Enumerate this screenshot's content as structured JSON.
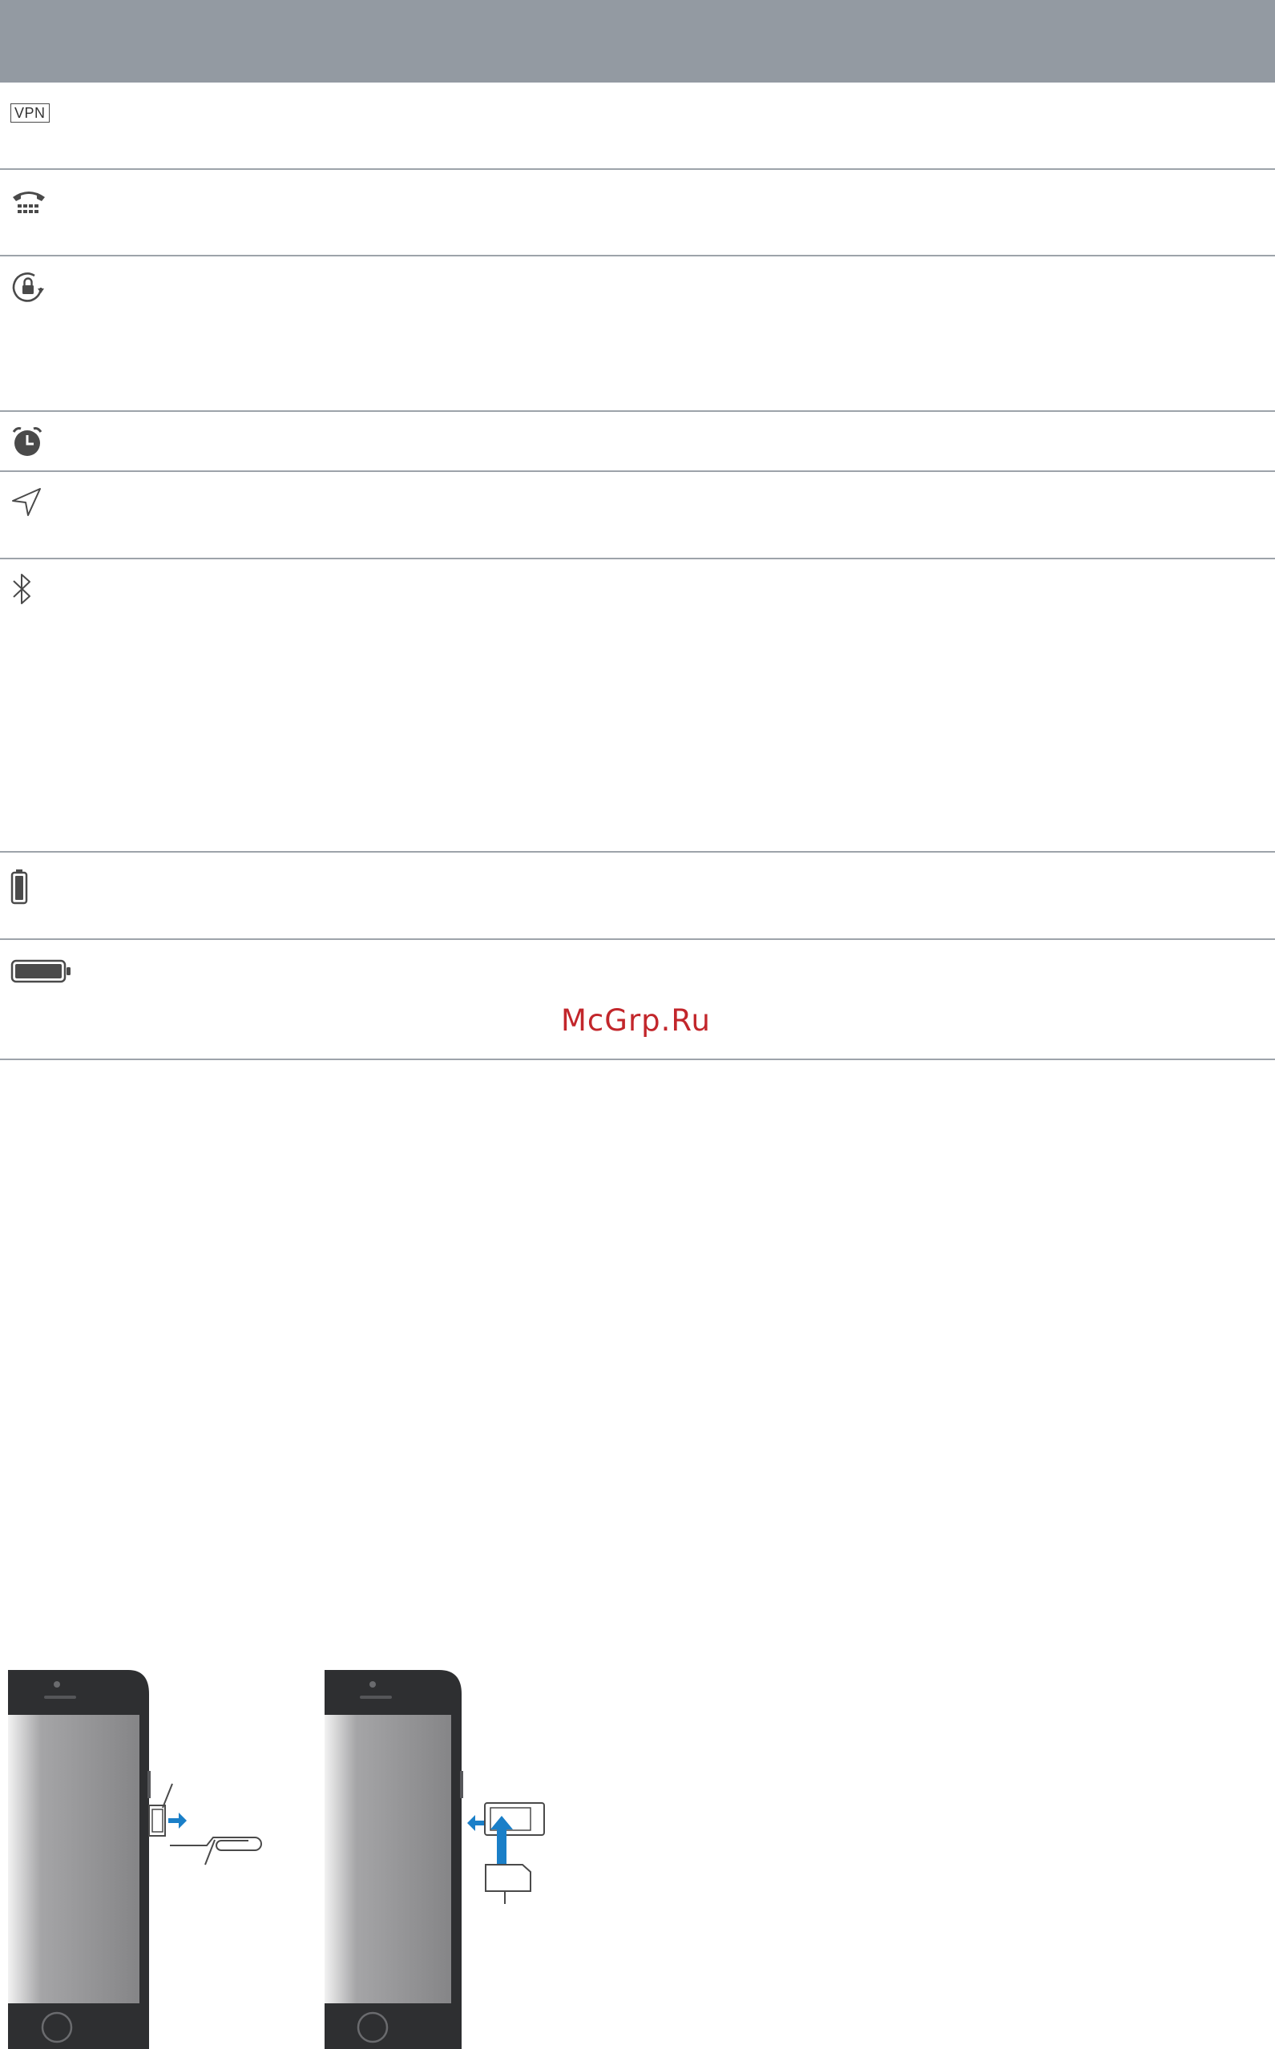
{
  "table": {
    "rows": [
      {
        "icon": "vpn-icon",
        "vpn_label": "VPN"
      },
      {
        "icon": "tty-icon"
      },
      {
        "icon": "orientation-lock-icon"
      },
      {
        "icon": "alarm-icon"
      },
      {
        "icon": "location-services-icon"
      },
      {
        "icon": "bluetooth-icon"
      },
      {
        "icon": "bluetooth-battery-icon"
      },
      {
        "icon": "battery-icon"
      }
    ]
  },
  "watermark": "McGrp.Ru",
  "colors": {
    "header": "#939aa2",
    "divider": "#9da3aa",
    "icon": "#4a4a4a",
    "watermark": "#c2262b",
    "arrow": "#1a7fc8",
    "phone_body": "#2e2f31",
    "screen": "#8e8e90"
  }
}
